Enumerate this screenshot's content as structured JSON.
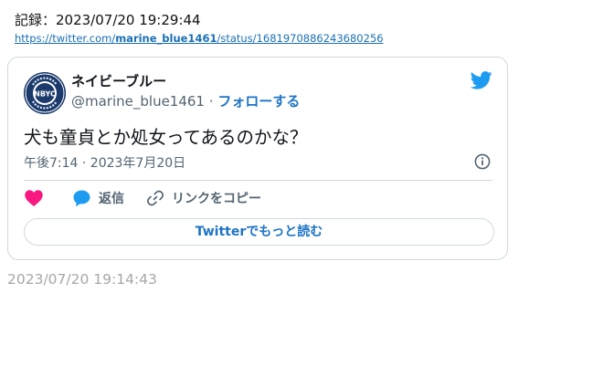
{
  "record_line": "記録：2023/07/20 19:29:44",
  "url": {
    "prefix": "https://twitter.com/",
    "user": "marine_blue1461",
    "suffix": "/status/1681970886243680256"
  },
  "tweet": {
    "display_name": "ネイビーブルー",
    "handle": "@marine_blue1461",
    "separator": "·",
    "follow_label": "フォローする",
    "text": "犬も童貞とか処女ってあるのかな？",
    "timestamp": "午後7:14 · 2023年7月20日",
    "avatar_text": "NBYC",
    "avatar_ring_text": "Navy Blue Yacht Club",
    "actions": {
      "reply_label": "返信",
      "copy_label": "リンクをコピー"
    },
    "read_more_label": "Twitterでもっと読む"
  },
  "footer_timestamp": "2023/07/20 19:14:43",
  "icons": {
    "twitter": "twitter-bird-icon",
    "info": "info-icon",
    "like": "heart-icon",
    "reply": "reply-bubble-icon",
    "link": "link-icon"
  },
  "colors": {
    "twitter_blue": "#1d9bf0",
    "link_blue": "#1d74c5",
    "heart_pink": "#f91880",
    "muted": "#536471"
  }
}
